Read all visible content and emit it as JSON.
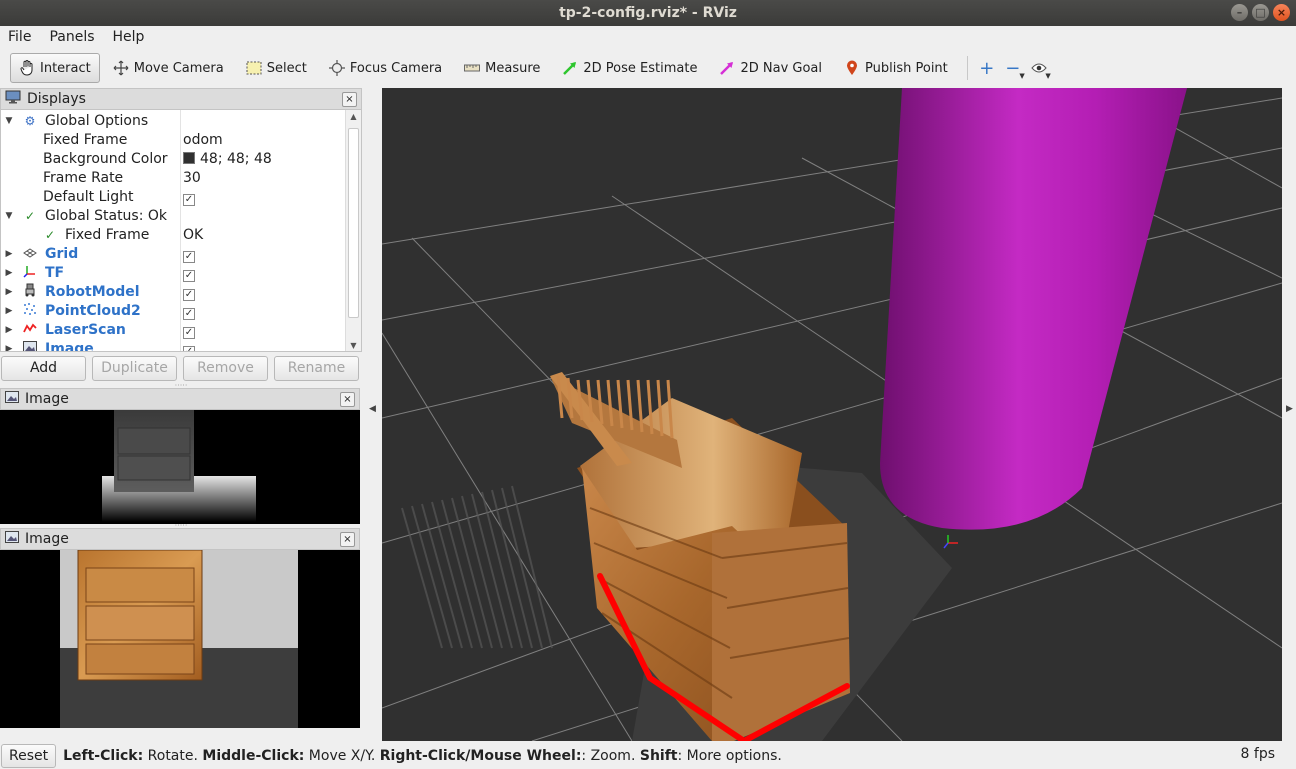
{
  "window": {
    "title": "tp-2-config.rviz* - RViz"
  },
  "menu": [
    "File",
    "Panels",
    "Help"
  ],
  "toolbar": {
    "tools": [
      {
        "label": "Interact",
        "icon": "hand-cursor-icon",
        "active": true
      },
      {
        "label": "Move Camera",
        "icon": "move-camera-icon"
      },
      {
        "label": "Select",
        "icon": "select-icon"
      },
      {
        "label": "Focus Camera",
        "icon": "focus-camera-icon"
      },
      {
        "label": "Measure",
        "icon": "ruler-icon"
      },
      {
        "label": "2D Pose Estimate",
        "icon": "pose-arrow-icon",
        "color": "#2ec62e"
      },
      {
        "label": "2D Nav Goal",
        "icon": "nav-arrow-icon",
        "color": "#d52fd5"
      },
      {
        "label": "Publish Point",
        "icon": "map-pin-icon",
        "color": "#d0451b"
      }
    ],
    "extras": [
      "add-tool-icon",
      "remove-tool-icon",
      "view-eye-icon"
    ]
  },
  "displays": {
    "title": "Displays",
    "global_options": {
      "label": "Global Options",
      "fixed_frame": {
        "label": "Fixed Frame",
        "value": "odom"
      },
      "background_color": {
        "label": "Background Color",
        "value": "48; 48; 48"
      },
      "frame_rate": {
        "label": "Frame Rate",
        "value": "30"
      },
      "default_light": {
        "label": "Default Light",
        "checked": true
      }
    },
    "global_status": {
      "label": "Global Status: Ok",
      "fixed_frame": {
        "label": "Fixed Frame",
        "value": "OK"
      }
    },
    "items": [
      {
        "label": "Grid",
        "icon": "grid-icon",
        "checked": true
      },
      {
        "label": "TF",
        "icon": "tf-axes-icon",
        "checked": true
      },
      {
        "label": "RobotModel",
        "icon": "robot-model-icon",
        "checked": true
      },
      {
        "label": "PointCloud2",
        "icon": "point-cloud-icon",
        "checked": true
      },
      {
        "label": "LaserScan",
        "icon": "laser-scan-icon",
        "checked": true
      },
      {
        "label": "Image",
        "icon": "image-icon",
        "checked": true
      }
    ],
    "buttons": {
      "add": "Add",
      "duplicate": "Duplicate",
      "remove": "Remove",
      "rename": "Rename"
    }
  },
  "image_panels": [
    {
      "title": "Image"
    },
    {
      "title": "Image"
    }
  ],
  "status": {
    "reset": "Reset",
    "hint": [
      {
        "key": "Left-Click:",
        "text": " Rotate. "
      },
      {
        "key": "Middle-Click:",
        "text": " Move X/Y. "
      },
      {
        "key": "Right-Click/Mouse Wheel:",
        "text": ": Zoom. "
      },
      {
        "key": "Shift",
        "text": ": More options."
      }
    ],
    "fps": "8 fps"
  },
  "colors": {
    "viewport_bg": "#303030",
    "cylinder": "#c51fc5",
    "laser": "#ff0000",
    "link_blue": "#2e72c8"
  }
}
